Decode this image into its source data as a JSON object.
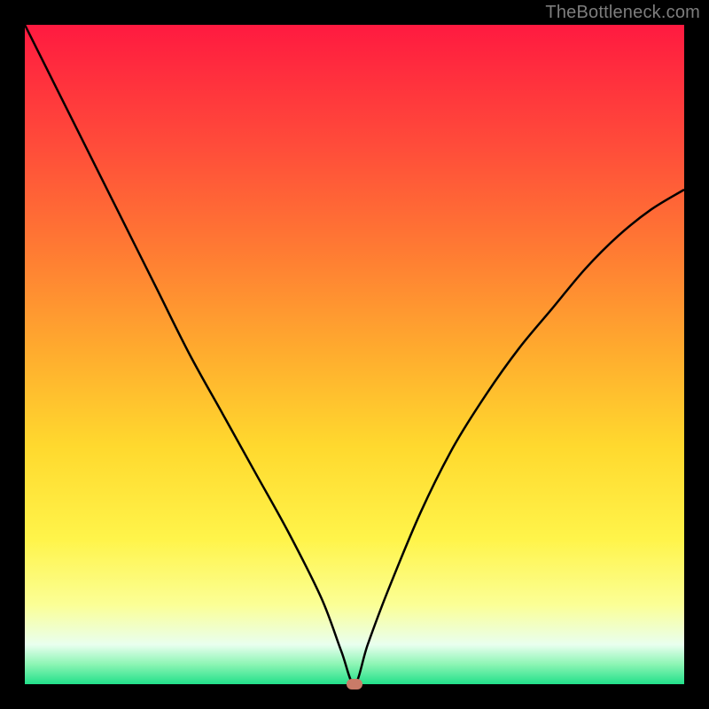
{
  "watermark": "TheBottleneck.com",
  "chart_data": {
    "type": "line",
    "title": "",
    "xlabel": "",
    "ylabel": "",
    "xlim": [
      0,
      100
    ],
    "ylim": [
      0,
      100
    ],
    "series": [
      {
        "name": "curve",
        "x": [
          0,
          5,
          10,
          15,
          20,
          25,
          30,
          35,
          40,
          45,
          48,
          50,
          52,
          55,
          60,
          65,
          70,
          75,
          80,
          85,
          90,
          95,
          100
        ],
        "values": [
          100,
          90,
          80,
          70,
          60,
          50,
          41,
          32,
          23,
          13,
          5,
          0,
          6,
          14,
          26,
          36,
          44,
          51,
          57,
          63,
          68,
          72,
          75
        ]
      }
    ],
    "marker": {
      "x": 50,
      "y": 0
    },
    "gradient_stops": [
      {
        "pos": 0,
        "color": "#ff1a40"
      },
      {
        "pos": 18,
        "color": "#ff4b3a"
      },
      {
        "pos": 34,
        "color": "#ff7a33"
      },
      {
        "pos": 50,
        "color": "#ffad2e"
      },
      {
        "pos": 64,
        "color": "#ffd92e"
      },
      {
        "pos": 78,
        "color": "#fff44a"
      },
      {
        "pos": 88,
        "color": "#fbff96"
      },
      {
        "pos": 94,
        "color": "#e9ffef"
      },
      {
        "pos": 97,
        "color": "#8cf5b4"
      },
      {
        "pos": 100,
        "color": "#22e08a"
      }
    ]
  }
}
